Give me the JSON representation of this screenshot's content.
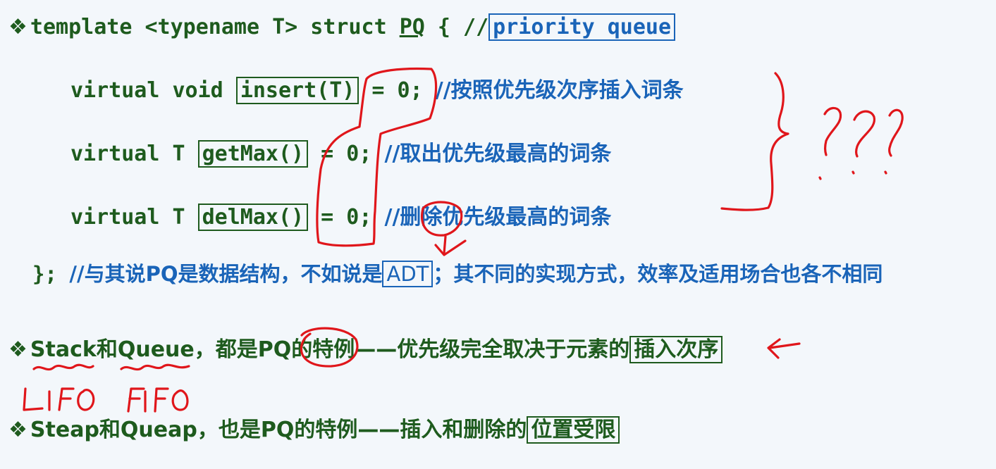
{
  "struct_line": {
    "bullet": "❖",
    "prefix": "template <typename T> struct ",
    "name": "PQ",
    "brace": " { //",
    "boxed_comment": "priority queue"
  },
  "methods": [
    {
      "prefix": "virtual void ",
      "name": "insert(T)",
      "suffix": " = 0; ",
      "comment": "//按照优先级次序插入词条"
    },
    {
      "prefix": "virtual T ",
      "name": "getMax()",
      "suffix": " = 0; ",
      "comment": "//取出优先级最高的词条"
    },
    {
      "prefix": "virtual T ",
      "name": "delMax()",
      "suffix": " = 0; ",
      "comment": "//删除优先级最高的词条"
    }
  ],
  "closing_line": {
    "code": "}; ",
    "comment_before": "//与其说PQ是数据结构，不如说是",
    "boxed": "ADT",
    "comment_after": "；其不同的实现方式，效率及适用场合也各不相同"
  },
  "bullet_stack": {
    "bullet": "❖",
    "stack": "Stack",
    "and": "和",
    "queue": "Queue",
    "text": "，都是PQ的特例——优先级完全取决于元素的",
    "boxed": "插入次序"
  },
  "bullet_steap": {
    "bullet": "❖",
    "text": "Steap和Queap，也是PQ的特例——插入和删除的",
    "boxed": "位置受限"
  },
  "annotations": {
    "ink_color": "#e0161b",
    "handwritten": [
      "LIFO",
      "FIFO",
      "???"
    ]
  }
}
